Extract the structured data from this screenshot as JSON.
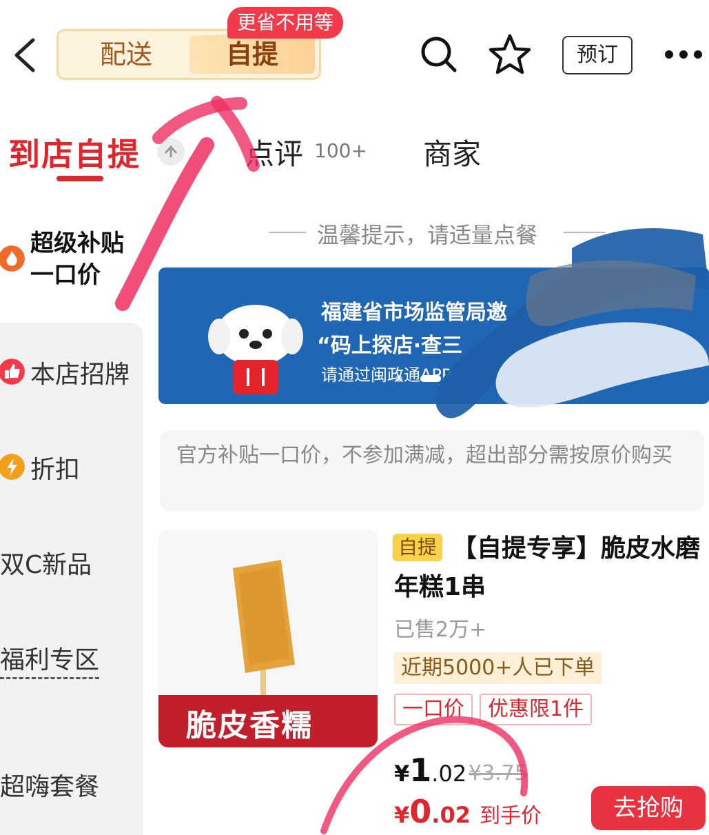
{
  "header": {
    "mode_toggle": {
      "delivery_label": "配送",
      "pickup_label": "自提",
      "selected": "自提"
    },
    "promo_badge": "更省不用等",
    "reserve_label": "预订",
    "icons": [
      "back-icon",
      "search-icon",
      "star-icon",
      "more-icon"
    ]
  },
  "tabs": {
    "pickup": "到店自提",
    "reviews": "点评",
    "reviews_count": "100+",
    "merchant": "商家"
  },
  "sidebar": {
    "items": [
      {
        "label_line1": "超级补贴",
        "label_line2": "一口价",
        "icon": "fire-icon",
        "active": true
      },
      {
        "label": "本店招牌",
        "icon": "thumbs-up-icon"
      },
      {
        "label": "折扣",
        "icon": "discount-icon"
      },
      {
        "label": "双C新品"
      },
      {
        "label": "福利专区"
      },
      {
        "label": "超嗨套餐"
      }
    ]
  },
  "tip": "温馨提示，请适量点餐",
  "banner": {
    "line1": "福建省市场监管局邀",
    "line2": "“码上探店·查三",
    "line3": "请通过闽政通APP"
  },
  "notice": "官方补贴一口价，不参加满减，超出部分需按原价购买",
  "product": {
    "image_caption": "脆皮香糯",
    "tag": "自提",
    "title": "【自提专享】脆皮水磨年糕1串",
    "sold": "已售2万+",
    "recent_orders": "近期5000+人已下单",
    "labels": [
      "一口价",
      "优惠限1件"
    ],
    "price_symbol": "¥",
    "price_int": "1",
    "price_dec": ".02",
    "original_price": "¥3.75",
    "final_symbol": "¥",
    "final_int": "0",
    "final_dec": ".02",
    "final_label": "到手价",
    "buy_label": "去抢购"
  },
  "colors": {
    "accent_red": "#e3242b",
    "banner_blue": "#1f66b4",
    "gold": "#fbd294"
  }
}
